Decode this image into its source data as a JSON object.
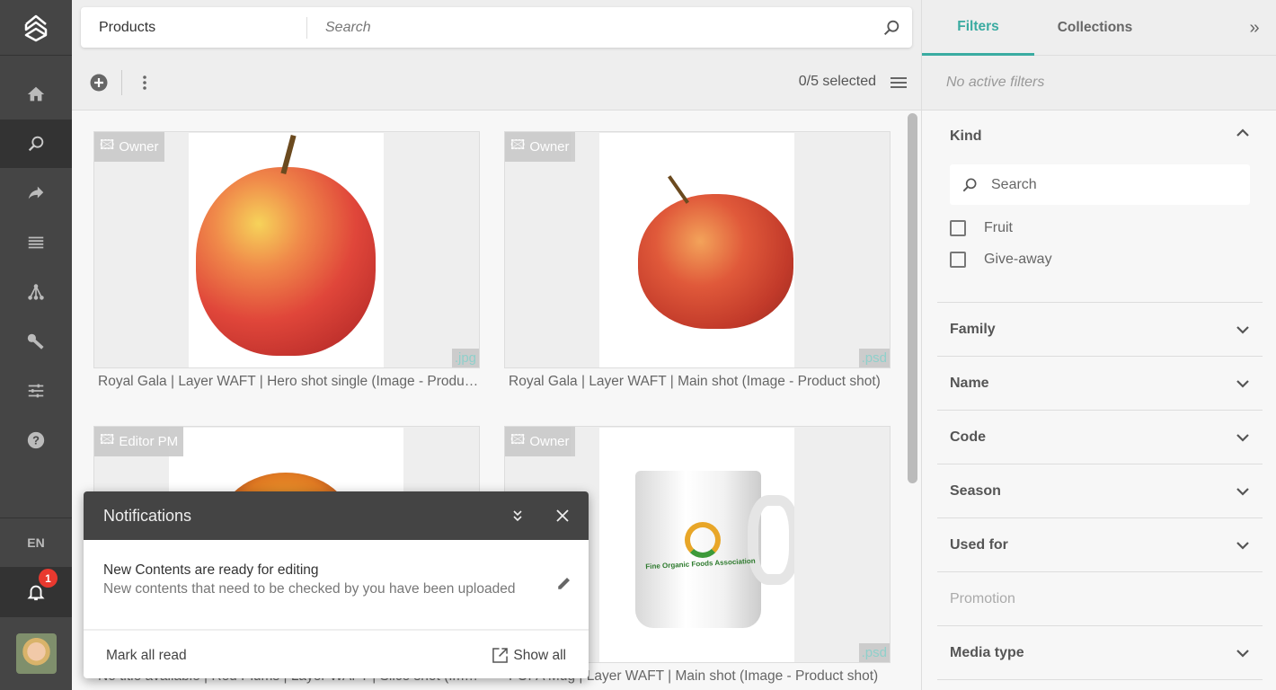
{
  "sidebar": {
    "language": "EN",
    "notification_count": "1",
    "items": [
      {
        "icon": "home-icon"
      },
      {
        "icon": "search-icon",
        "active": true
      },
      {
        "icon": "share-icon"
      },
      {
        "icon": "list-icon"
      },
      {
        "icon": "hierarchy-icon"
      },
      {
        "icon": "key-icon"
      },
      {
        "icon": "sliders-icon"
      },
      {
        "icon": "help-icon"
      }
    ]
  },
  "header": {
    "scope": "Products",
    "search_placeholder": "Search"
  },
  "toolbar": {
    "selected": "0/5 selected"
  },
  "grid": {
    "items": [
      {
        "role": "Owner",
        "ext": ".jpg",
        "caption": "Royal Gala | Layer WAFT | Hero shot single (Image - Product shot)"
      },
      {
        "role": "Owner",
        "ext": ".psd",
        "caption": "Royal Gala | Layer WAFT | Main shot (Image - Product shot)"
      },
      {
        "role": "Editor PM",
        "ext": "",
        "caption": "No title available | Red Plums | Layer WAFT | Slice shot (Image - Product shot)"
      },
      {
        "role": "Owner",
        "ext": ".psd",
        "caption": "FOFA Mug | Layer WAFT | Main shot (Image - Product shot)",
        "logo_text": "Fine Organic Foods Association"
      }
    ]
  },
  "filters": {
    "tabs": [
      "Filters",
      "Collections"
    ],
    "active_tab": "Filters",
    "accent": "#3aaba1",
    "no_active": "No active filters",
    "kind": {
      "title": "Kind",
      "search_placeholder": "Search",
      "options": [
        "Fruit",
        "Give-away"
      ]
    },
    "sections": [
      {
        "title": "Family"
      },
      {
        "title": "Name"
      },
      {
        "title": "Code"
      },
      {
        "title": "Season"
      },
      {
        "title": "Used for"
      },
      {
        "title": "Promotion",
        "disabled": true
      },
      {
        "title": "Media type"
      }
    ]
  },
  "notifications": {
    "title": "Notifications",
    "item_title": "New Contents are ready for editing",
    "item_text": "New contents that need to be checked by you have been uploaded",
    "mark_all": "Mark all read",
    "show_all": "Show all"
  }
}
